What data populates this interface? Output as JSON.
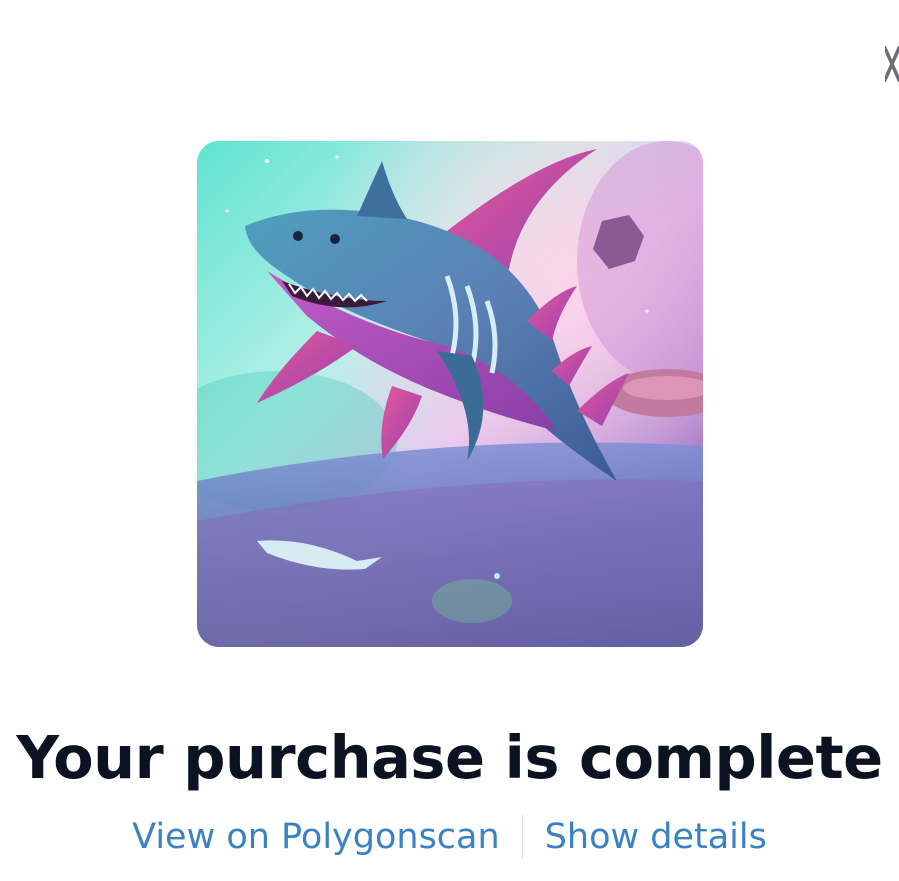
{
  "modal": {
    "title": "Your purchase is complete",
    "view_link_label": "View on Polygonscan",
    "details_link_label": "Show details"
  },
  "icons": {
    "close": "close-icon"
  },
  "colors": {
    "title": "#0b1221",
    "link": "#3b82c4",
    "divider": "#d6d9de"
  }
}
